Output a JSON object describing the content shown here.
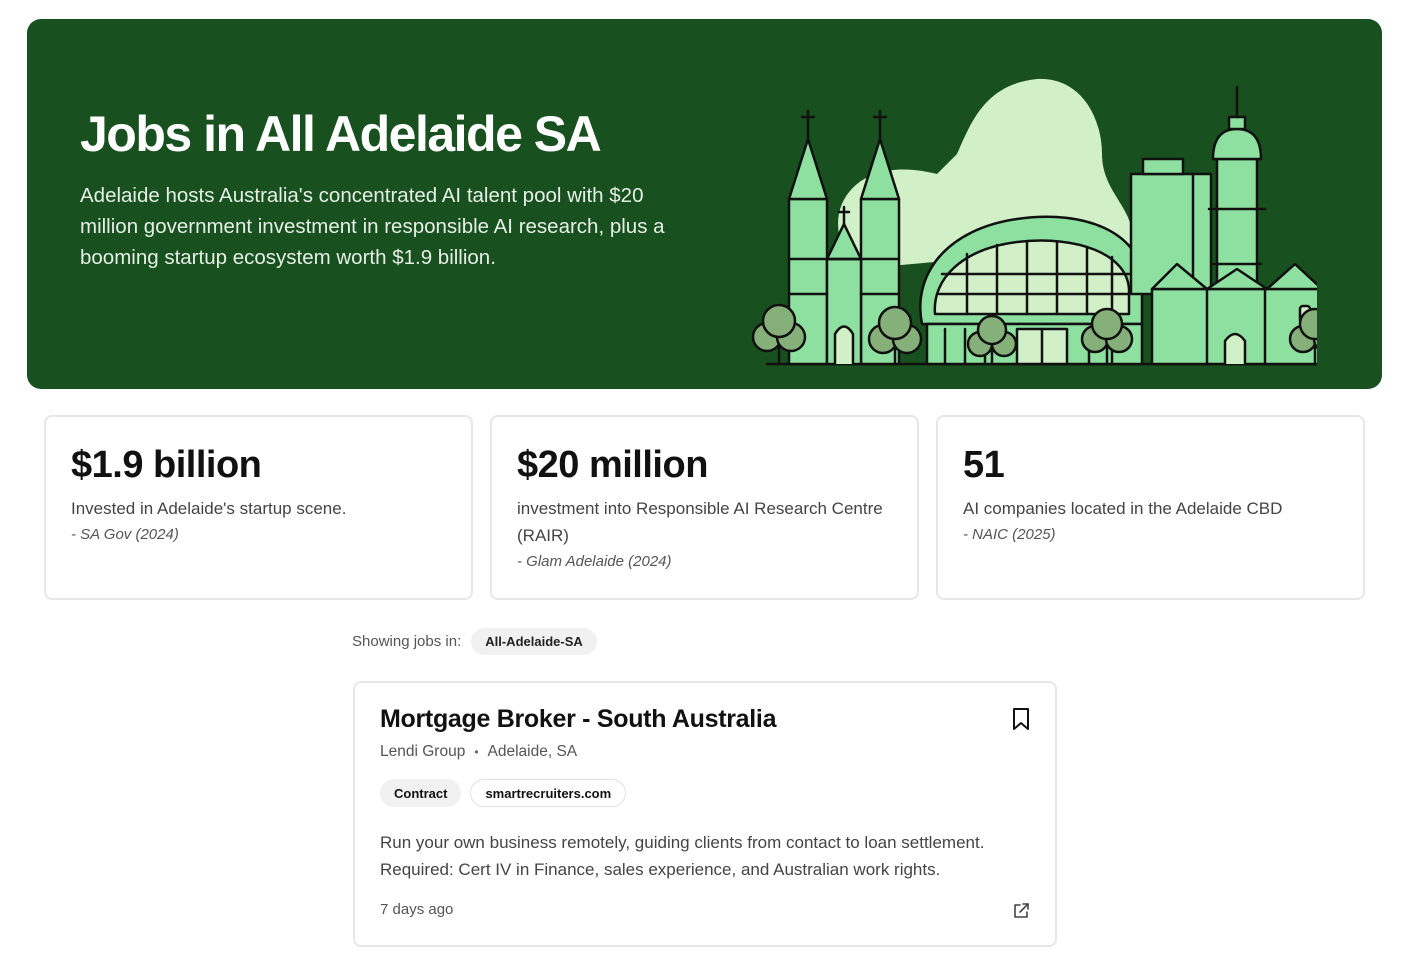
{
  "hero": {
    "title": "Jobs in All Adelaide SA",
    "description": "Adelaide hosts Australia's concentrated AI talent pool with $20 million government investment in responsible AI research, plus a booming startup ecosystem worth $1.9 billion."
  },
  "stats": [
    {
      "value": "$1.9 billion",
      "label": "Invested in Adelaide's startup scene.",
      "source": "- SA Gov (2024)"
    },
    {
      "value": "$20 million",
      "label": "investment into Responsible AI Research Centre (RAIR)",
      "source": "- Glam Adelaide (2024)"
    },
    {
      "value": "51",
      "label": "AI companies located in the Adelaide CBD",
      "source": "- NAIC (2025)"
    }
  ],
  "filter": {
    "label": "Showing jobs in:",
    "chip": "All-Adelaide-SA"
  },
  "job": {
    "title": "Mortgage Broker - South Australia",
    "company": "Lendi Group",
    "separator": "•",
    "location": "Adelaide, SA",
    "tags": [
      "Contract",
      "smartrecruiters.com"
    ],
    "description": "Run your own business remotely, guiding clients from contact to loan settlement. Required: Cert IV in Finance, sales experience, and Australian work rights.",
    "posted": "7 days ago"
  },
  "icons": {
    "bookmark": "bookmark-icon",
    "external": "external-link-icon",
    "illustration": "adelaide-skyline-illustration"
  },
  "colors": {
    "hero_bg": "#18501f",
    "illus_light": "#d2f0c8",
    "illus_mid": "#8ee0a0",
    "tree": "#86b07a"
  }
}
